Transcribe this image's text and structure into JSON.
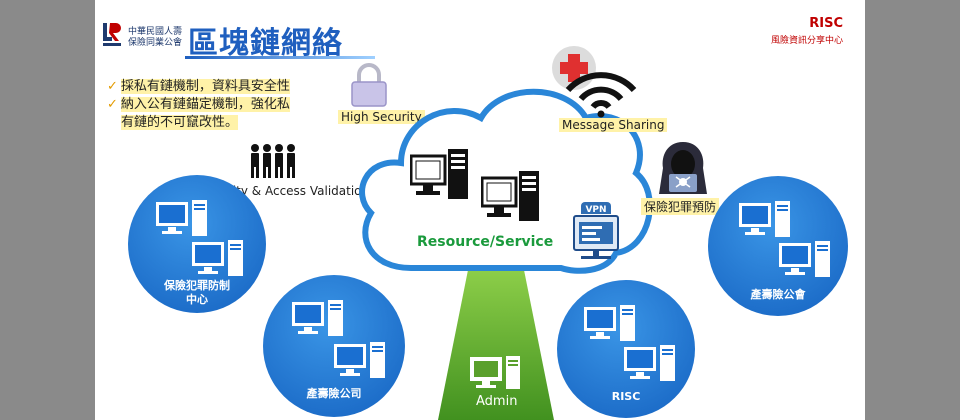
{
  "header": {
    "org_line1": "中華民國人壽",
    "org_line2": "保險同業公會",
    "title": "區塊鏈網絡",
    "risc_title": "RISC",
    "risc_subtitle": "風險資訊分享中心"
  },
  "bullets": {
    "item1": "採私有鏈機制，資料具安全性",
    "item2_line1": "納入公有鏈錨定機制，強化私",
    "item2_line2": "有鏈的不可竄改性。"
  },
  "labels": {
    "high_security": "High Security",
    "identity": "Identity & Access Validation",
    "message_sharing": "Message Sharing",
    "crime_prevention": "保險犯罪預防",
    "resource_service": "Resource/Service",
    "vpn": "VPN",
    "admin": "Admin"
  },
  "nodes": {
    "left_line1": "保險犯罪防制",
    "left_line2": "中心",
    "life_company": "產壽險公司",
    "risc": "RISC",
    "association": "產壽險公會"
  },
  "colors": {
    "accent_blue": "#1f5fbf",
    "node_blue": "#1a6fd1",
    "risc_red": "#c00000",
    "admin_green": "#5aa02c",
    "highlight": "#fff2a8"
  }
}
